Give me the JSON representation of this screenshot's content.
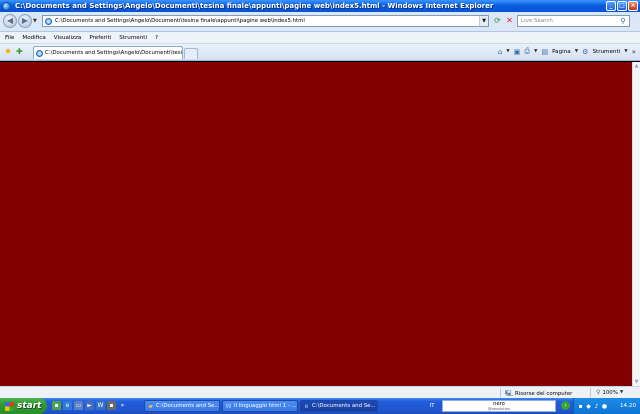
{
  "window": {
    "title": "C:\\Documents and Settings\\Angelo\\Documenti\\tesina finale\\appunti\\pagine web\\index5.html - Windows Internet Explorer",
    "controls": [
      "_",
      "□",
      "×"
    ]
  },
  "address_bar": {
    "url": "C:\\Documents and Settings\\Angelo\\Documenti\\tesina finale\\appunti\\pagine web\\index5.html",
    "search_placeholder": "Live Search"
  },
  "menu": [
    "File",
    "Modifica",
    "Visualizza",
    "Preferiti",
    "Strumenti",
    "?"
  ],
  "tab": {
    "label": "C:\\Documents and Settings\\Angelo\\Documenti\\tesina ..."
  },
  "command_bar": {
    "page_label": "Pagina",
    "tools_label": "Strumenti"
  },
  "content": {
    "background_color": "#800000"
  },
  "status_bar": {
    "zone": "Risorse del computer",
    "zoom": "100%"
  },
  "taskbar": {
    "start_label": "start",
    "buttons": [
      "C:\\Documents and Se...",
      "Il linguaggio html 1 - ...",
      "C:\\Documents and Se..."
    ],
    "language": "IT",
    "toolbar_box_title": "nero",
    "toolbar_box_sub": "@absolution",
    "clock": "14.20"
  }
}
